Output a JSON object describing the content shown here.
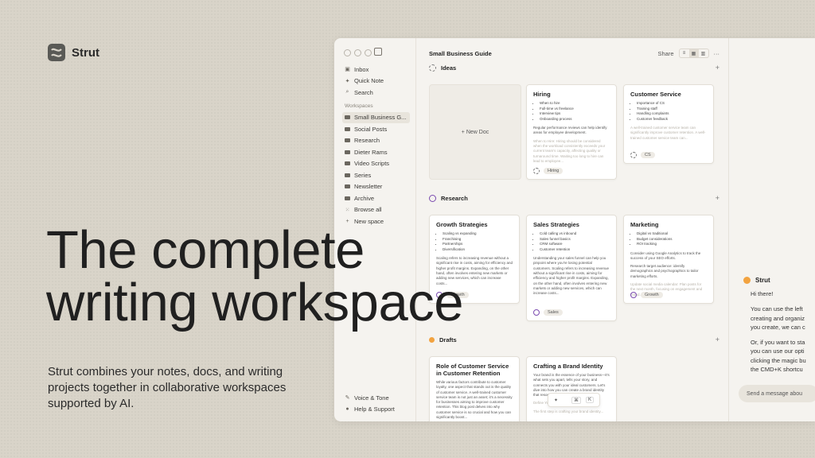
{
  "brand": {
    "name": "Strut"
  },
  "hero": {
    "headline_line1": "The complete",
    "headline_line2": "writing workspace",
    "subtitle": "Strut combines your notes, docs, and writing projects together in collaborative workspaces supported by AI."
  },
  "sidebar": {
    "top_items": [
      {
        "label": "Inbox",
        "icon": "inbox-icon"
      },
      {
        "label": "Quick Note",
        "icon": "sparkle-icon"
      },
      {
        "label": "Search",
        "icon": "search-icon"
      }
    ],
    "workspaces_label": "Workspaces",
    "workspaces": [
      {
        "label": "Small Business G..."
      },
      {
        "label": "Social Posts"
      },
      {
        "label": "Research"
      },
      {
        "label": "Dieter Rams"
      },
      {
        "label": "Video Scripts"
      },
      {
        "label": "Series"
      },
      {
        "label": "Newsletter"
      },
      {
        "label": "Archive"
      },
      {
        "label": "Browse all"
      },
      {
        "label": "New space"
      }
    ],
    "bottom_items": [
      {
        "label": "Voice & Tone"
      },
      {
        "label": "Help & Support"
      }
    ]
  },
  "main": {
    "title": "Small Business Guide",
    "share_label": "Share",
    "more_label": "···",
    "sections": [
      {
        "label": "Ideas"
      },
      {
        "label": "Research"
      },
      {
        "label": "Drafts"
      }
    ],
    "new_doc_label": "+ New Doc",
    "cards": {
      "hiring": {
        "title": "Hiring",
        "bullets": [
          "When to hire",
          "Full-time vs freelance",
          "Interview tips",
          "Onboarding process"
        ],
        "p1": "Regular performance reviews can help identify areas for employee development.",
        "p2": "When to Hire: Hiring should be considered when the workload consistently exceeds your current team's capacity, affecting quality or turnaround time. Waiting too long to hire can lead to employee...",
        "tag": "Hiring"
      },
      "customer_service": {
        "title": "Customer Service",
        "bullets": [
          "Importance of CS",
          "Training staff",
          "Handling complaints",
          "Customer feedback"
        ],
        "p1": "A well-trained customer service team can significantly improve customer retention. A well-trained customer service team can...",
        "tag": "CS"
      },
      "growth": {
        "title": "Growth Strategies",
        "bullets": [
          "Scaling vs expanding",
          "Franchising",
          "Partnerships",
          "Diversification"
        ],
        "p1": "Scaling refers to increasing revenue without a significant rise in costs, aiming for efficiency and higher profit margins. Expanding, on the other hand, often involves entering new markets or adding new services, which can increase costs...",
        "tag": "Growth"
      },
      "sales": {
        "title": "Sales Strategies",
        "bullets": [
          "Cold calling vs inbound",
          "Sales funnel basics",
          "CRM software",
          "Customer retention"
        ],
        "p1": "Understanding your sales funnel can help you pinpoint where you're losing potential customers. Scaling refers to increasing revenue without a significant rise in costs, aiming for efficiency and higher profit margins. Expanding, on the other hand, often involves entering new markets or adding new services, which can increase costs...",
        "tag": "Sales"
      },
      "marketing": {
        "title": "Marketing",
        "bullets": [
          "Digital vs traditional",
          "Budget considerations",
          "ROI tracking"
        ],
        "p1": "Consider using Google Analytics to track the success of your SEO efforts.",
        "p2": "Research target audience: identify demographics and psychographics to tailor marketing efforts.",
        "p3": "Update social media calendar: Plan posts for the next month, focusing on engagement and brand...",
        "tag": "Growth"
      },
      "role_cs": {
        "title": "Role of Customer Service in Customer Retention",
        "p1": "While various factors contribute to customer loyalty, one aspect that stands out is the quality of customer service. A well-trained customer service team is not just an asset; it's a necessity for businesses aiming to improve customer retention. This blog post delves into why customer service is so crucial and how you can significantly boost..."
      },
      "brand": {
        "title": "Crafting a Brand Identity",
        "p1": "Your brand is the essence of your business—it's what sets you apart, tells your story, and connects you with your ideal customers. Let's dive into how you can create a brand identity that resonates and endures.",
        "p2": "Define Your Brand",
        "p3": "The first step is crafting your brand identity..."
      }
    },
    "ai_bar": {
      "cmd": "⌘",
      "key": "K"
    }
  },
  "chat": {
    "name": "Strut",
    "greeting": "Hi there!",
    "line1": "You can use the left ",
    "line2": "creating and organiz",
    "line3": "you create, we can c",
    "line4": "Or, if you want to sta",
    "line5": "you can use our opti",
    "line6": "clicking the magic bu",
    "line7": "the CMD+K shortcu",
    "input_placeholder": "Send a message abou"
  },
  "colors": {
    "background": "#d9d4c9",
    "app": "#f5f3ef",
    "research_accent": "#7b4bb0",
    "drafts_accent": "#f2a340"
  }
}
